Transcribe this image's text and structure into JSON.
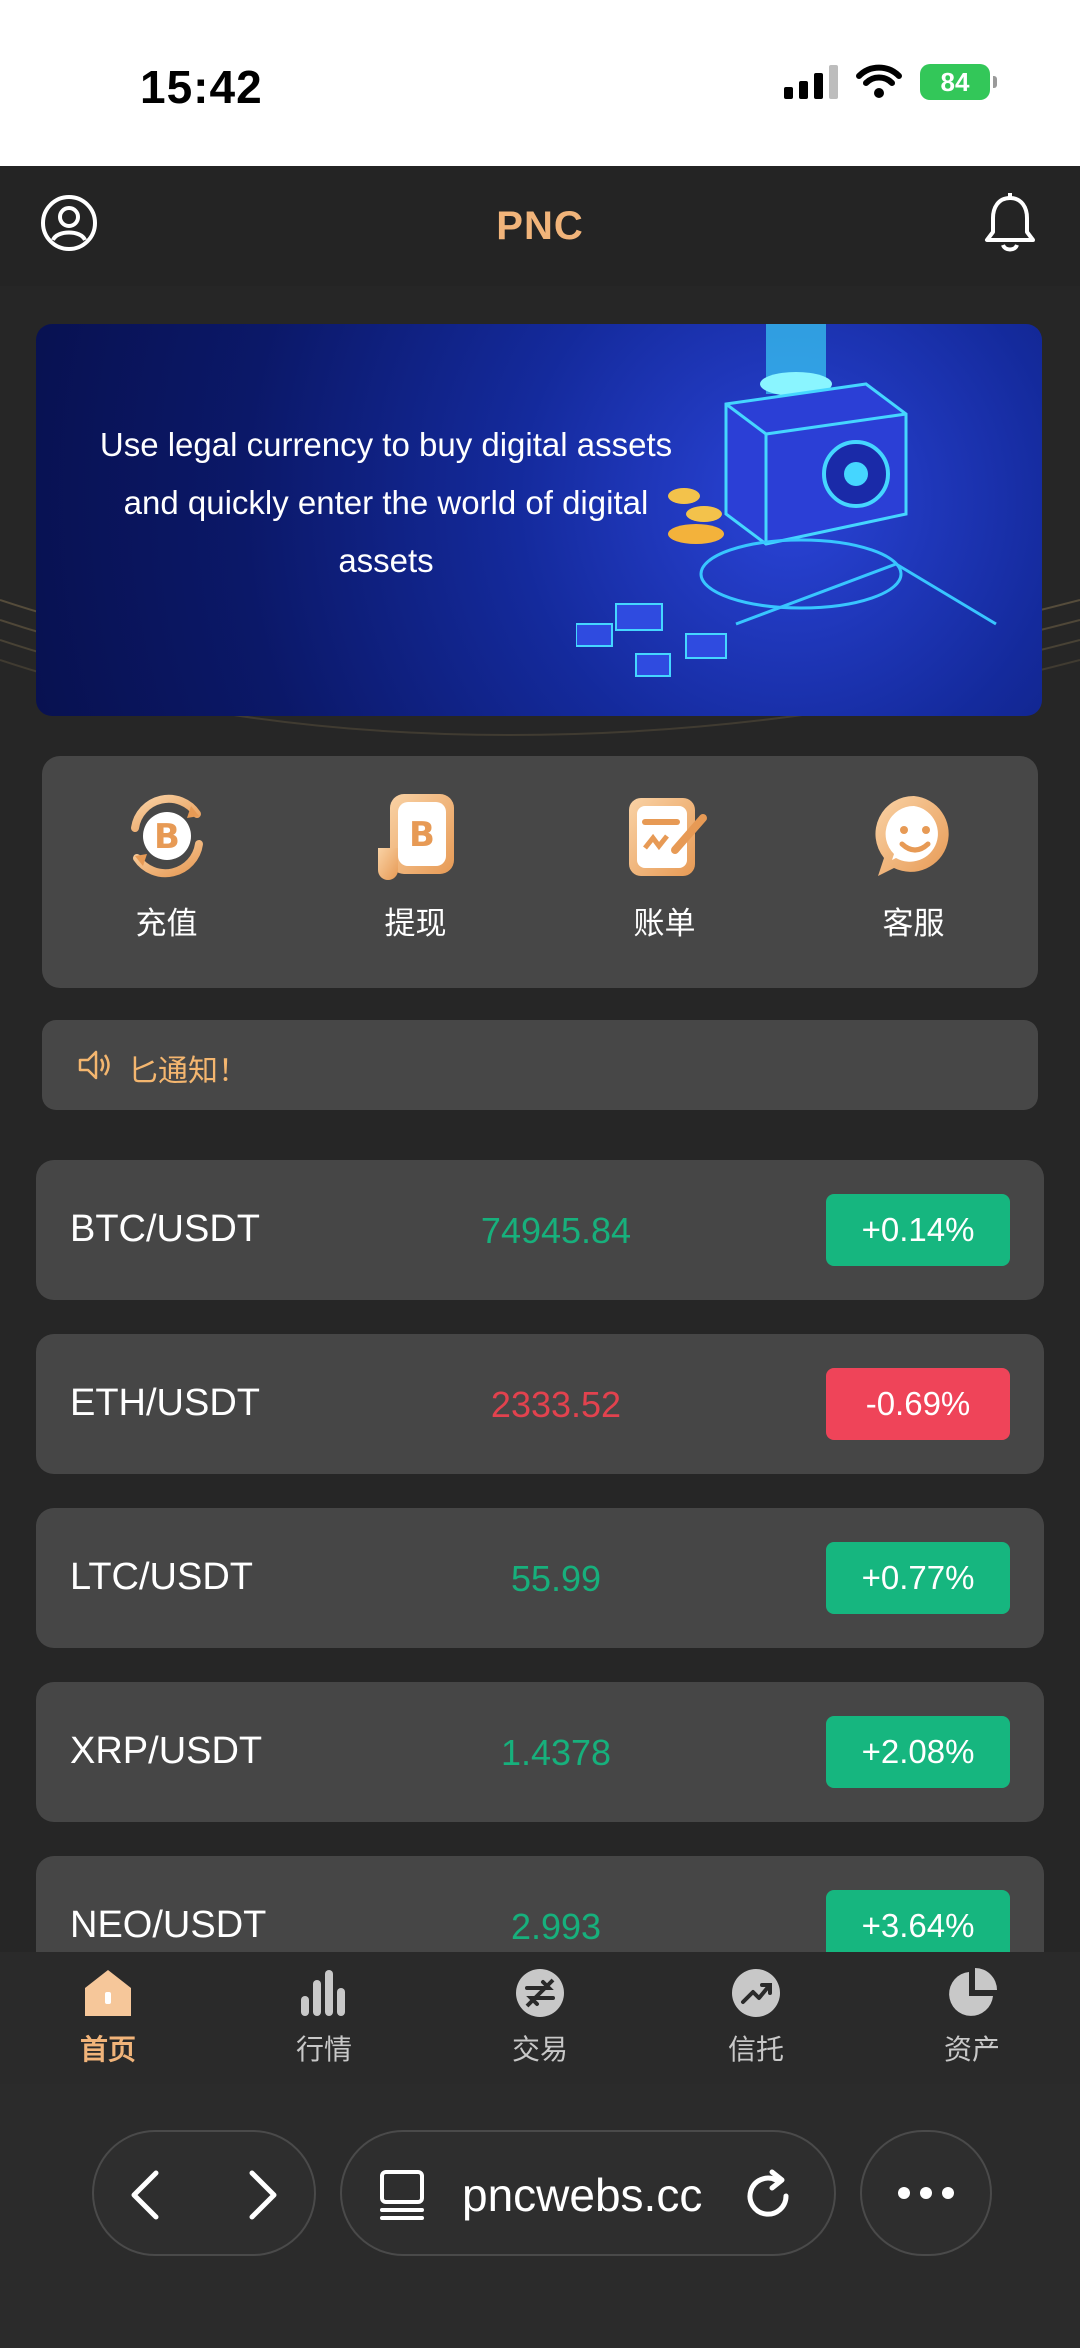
{
  "status_bar": {
    "time": "15:42",
    "battery": "84"
  },
  "header": {
    "title": "PNC"
  },
  "banner": {
    "text": "Use legal currency to buy digital assets and quickly enter the world of digital assets"
  },
  "quick_menu": [
    {
      "label": "充值",
      "icon": "bitcoin-cycle-icon"
    },
    {
      "label": "提现",
      "icon": "bitcoin-scroll-icon"
    },
    {
      "label": "账单",
      "icon": "bill-icon"
    },
    {
      "label": "客服",
      "icon": "smile-chat-icon"
    }
  ],
  "notice": {
    "text": "匕通知！"
  },
  "market": [
    {
      "pair": "BTC/USDT",
      "price": "74945.84",
      "change": "+0.14%",
      "direction": "up"
    },
    {
      "pair": "ETH/USDT",
      "price": "2333.52",
      "change": "-0.69%",
      "direction": "down"
    },
    {
      "pair": "LTC/USDT",
      "price": "55.99",
      "change": "+0.77%",
      "direction": "up"
    },
    {
      "pair": "XRP/USDT",
      "price": "1.4378",
      "change": "+2.08%",
      "direction": "up"
    },
    {
      "pair": "NEO/USDT",
      "price": "2.993",
      "change": "+3.64%",
      "direction": "up"
    }
  ],
  "tabbar": [
    {
      "label": "首页",
      "icon": "home-icon",
      "active": true
    },
    {
      "label": "行情",
      "icon": "bars-icon",
      "active": false
    },
    {
      "label": "交易",
      "icon": "exchange-icon",
      "active": false
    },
    {
      "label": "信托",
      "icon": "trend-icon",
      "active": false
    },
    {
      "label": "资产",
      "icon": "pie-icon",
      "active": false
    }
  ],
  "browser": {
    "url": "pncwebs.cc"
  },
  "colors": {
    "up": "#16b67f",
    "down": "#ef4459",
    "accent": "#f1b47a",
    "up_text": "#17b07c",
    "down_text": "#e2424e"
  }
}
